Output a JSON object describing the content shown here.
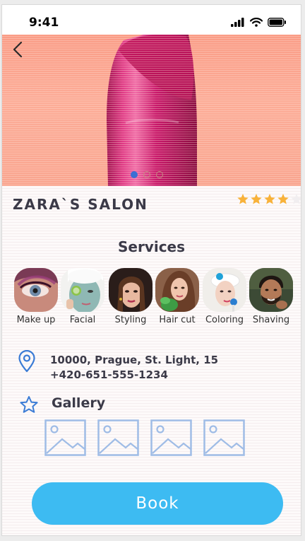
{
  "status_bar": {
    "time": "9:41"
  },
  "hero": {
    "slides_total": 3,
    "active_slide": 1
  },
  "salon": {
    "name": "ZARA`S SALON",
    "rating": 4,
    "rating_max": 5
  },
  "services": {
    "title": "Services",
    "items": [
      {
        "label": "Make up"
      },
      {
        "label": "Facial"
      },
      {
        "label": "Styling"
      },
      {
        "label": "Hair cut"
      },
      {
        "label": "Coloring"
      },
      {
        "label": "Shaving"
      }
    ]
  },
  "contact": {
    "address": "10000, Prague, St. Light, 15",
    "phone": "+420-651-555-1234"
  },
  "gallery": {
    "title": "Gallery",
    "count": 4
  },
  "book_button": {
    "label": "Book"
  },
  "colors": {
    "accent": "#3dbbf2",
    "icon_blue": "#3a7bd5",
    "star": "#f8b23a",
    "hero_bg": "#fca893",
    "lipstick": "#d01e6a"
  },
  "icons": [
    "back-chevron-icon",
    "signal-icon",
    "wifi-icon",
    "battery-icon",
    "location-pin-icon",
    "star-outline-icon",
    "image-placeholder-icon"
  ]
}
